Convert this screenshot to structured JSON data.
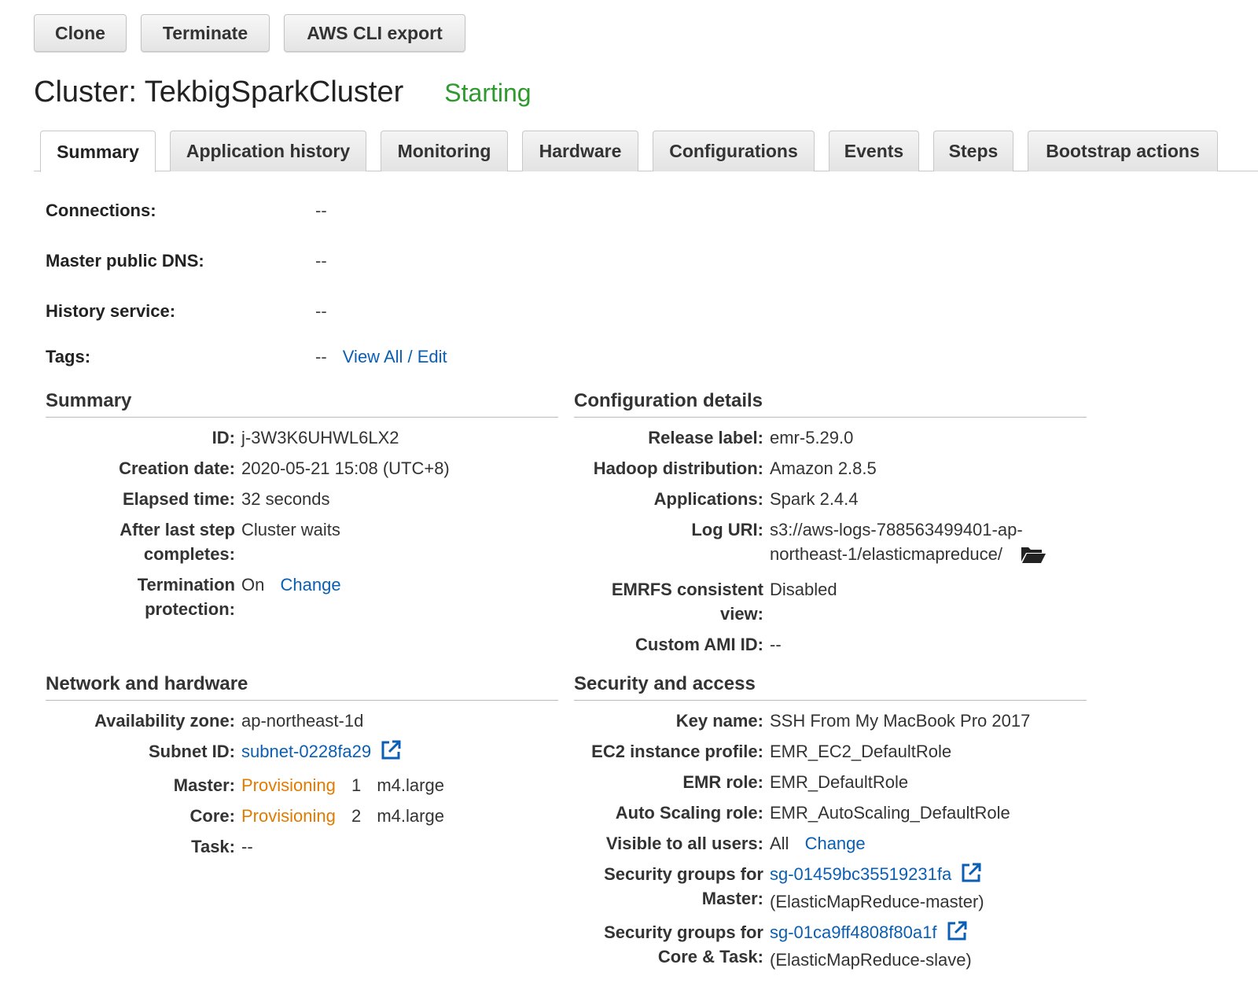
{
  "toolbar": {
    "clone": "Clone",
    "terminate": "Terminate",
    "cli_export": "AWS CLI export"
  },
  "header": {
    "title": "Cluster: TekbigSparkCluster",
    "status": "Starting",
    "status_color": "#2e9a2e"
  },
  "tabs": [
    {
      "label": "Summary",
      "active": true
    },
    {
      "label": "Application history"
    },
    {
      "label": "Monitoring"
    },
    {
      "label": "Hardware"
    },
    {
      "label": "Configurations"
    },
    {
      "label": "Events"
    },
    {
      "label": "Steps"
    },
    {
      "label": "Bootstrap actions"
    }
  ],
  "connections": {
    "connections_label": "Connections:",
    "connections_value": "--",
    "dns_label": "Master public DNS:",
    "dns_value": "--",
    "history_label": "History service:",
    "history_value": "--",
    "tags_label": "Tags:",
    "tags_value": "--",
    "tags_link": "View All / Edit"
  },
  "summary": {
    "title": "Summary",
    "id_label": "ID:",
    "id_value": "j-3W3K6UHWL6LX2",
    "created_label": "Creation date:",
    "created_value": "2020-05-21 15:08 (UTC+8)",
    "elapsed_label": "Elapsed time:",
    "elapsed_value": "32 seconds",
    "after_label_1": "After last step",
    "after_label_2": "completes:",
    "after_value": "Cluster waits",
    "term_label_1": "Termination",
    "term_label_2": "protection:",
    "term_value": "On",
    "term_link": "Change"
  },
  "config": {
    "title": "Configuration details",
    "release_label": "Release label:",
    "release_value": "emr-5.29.0",
    "hadoop_label": "Hadoop distribution:",
    "hadoop_value": "Amazon 2.8.5",
    "apps_label": "Applications:",
    "apps_value": "Spark 2.4.4",
    "log_label": "Log URI:",
    "log_value_1": "s3://aws-logs-788563499401-ap-",
    "log_value_2": "northeast-1/elasticmapreduce/",
    "emrfs_label_1": "EMRFS consistent",
    "emrfs_label_2": "view:",
    "emrfs_value": "Disabled",
    "ami_label": "Custom AMI ID:",
    "ami_value": "--"
  },
  "network": {
    "title": "Network and hardware",
    "az_label": "Availability zone:",
    "az_value": "ap-northeast-1d",
    "subnet_label": "Subnet ID:",
    "subnet_value": "subnet-0228fa29",
    "master_label": "Master:",
    "master_status": "Provisioning",
    "master_count": "1",
    "master_type": "m4.large",
    "core_label": "Core:",
    "core_status": "Provisioning",
    "core_count": "2",
    "core_type": "m4.large",
    "task_label": "Task:",
    "task_value": "--"
  },
  "security": {
    "title": "Security and access",
    "key_label": "Key name:",
    "key_value": "SSH From My MacBook Pro 2017",
    "ec2_label": "EC2 instance profile:",
    "ec2_value": "EMR_EC2_DefaultRole",
    "emr_label": "EMR role:",
    "emr_value": "EMR_DefaultRole",
    "as_label": "Auto Scaling role:",
    "as_value": "EMR_AutoScaling_DefaultRole",
    "vis_label": "Visible to all users:",
    "vis_value": "All",
    "vis_link": "Change",
    "sgm_label_1": "Security groups for",
    "sgm_label_2": "Master:",
    "sgm_link": "sg-01459bc35519231fa",
    "sgm_desc": "(ElasticMapReduce-master)",
    "sgc_label_1": "Security groups for",
    "sgc_label_2": "Core & Task:",
    "sgc_link": "sg-01ca9ff4808f80a1f",
    "sgc_desc": "(ElasticMapReduce-slave)"
  },
  "colors": {
    "link": "#0a5fb4",
    "provisioning": "#e07b00"
  },
  "icons": {
    "external_link": "external-link-icon",
    "folder": "folder-open-icon"
  }
}
